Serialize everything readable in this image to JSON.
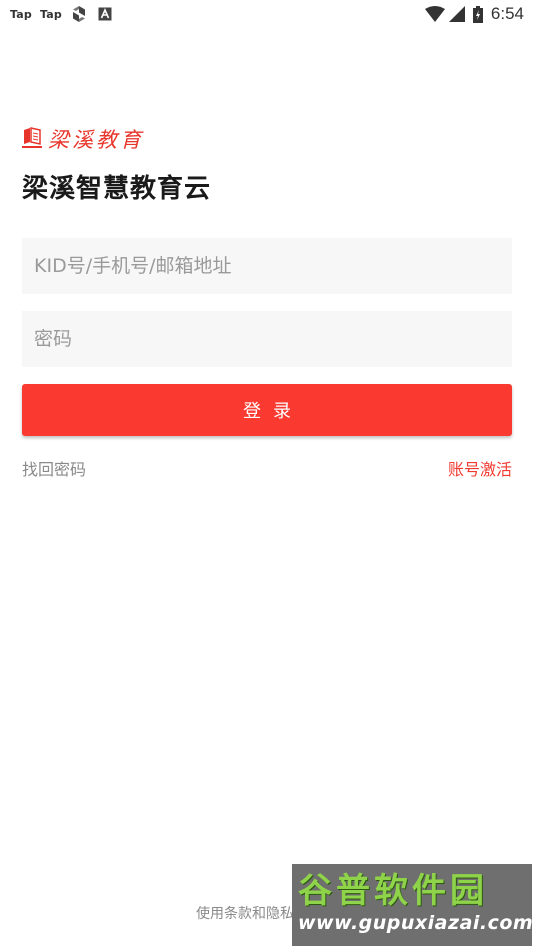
{
  "status_bar": {
    "left_labels": [
      "Tap",
      "Tap"
    ],
    "time": "6:54",
    "icons": [
      "sync-icon",
      "a-icon",
      "wifi-icon",
      "signal-icon",
      "battery-icon"
    ]
  },
  "brand": {
    "logo_text": "梁溪教育",
    "title": "梁溪智慧教育云",
    "logo_color": "#e8352b"
  },
  "form": {
    "account_placeholder": "KID号/手机号/邮箱地址",
    "password_placeholder": "密码",
    "login_label": "登录",
    "forgot_label": "找回密码",
    "activate_label": "账号激活"
  },
  "footer": {
    "terms_label": "使用条款和隐私"
  },
  "watermark": {
    "main": "谷普软件园",
    "url": "www.gupuxiazai.com"
  },
  "colors": {
    "accent": "#fa3930",
    "input_bg": "#f7f7f7",
    "link_accent": "#f23a30"
  }
}
